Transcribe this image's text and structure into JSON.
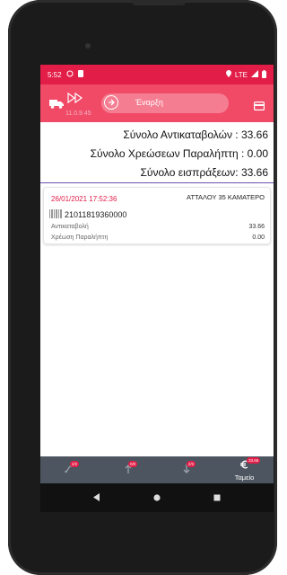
{
  "status_bar": {
    "time": "5:52",
    "network": "LTE"
  },
  "app_bar": {
    "version": "11.0.9.45",
    "start_label": "Έναρξη"
  },
  "totals": {
    "cod_total": "Σύνολο Αντικαταβολών :  33.66",
    "recipient_charges_total": "Σύνολο Χρεώσεων Παραλήπτη :   0.00",
    "receipts_total": "Σύνολο εισπράξεων:  33.66"
  },
  "items": [
    {
      "date": "26/01/2021 17:52:36",
      "address": "ΑΤΤΑΛΟΥ 35 ΚΑΜΑΤΕΡΟ",
      "barcode": "21011819360000",
      "cod_label": "Αντικαταβολή",
      "cod_value": "33.66",
      "charge_label": "Χρέωση Παραλήπτη",
      "charge_value": "0.00"
    }
  ],
  "bottom_nav": {
    "tab1_badge": "2/2",
    "tab2_badge": "0/0",
    "tab3_badge": "2/2",
    "cashier_badge": "33.66",
    "cashier_label": "Ταμείο"
  },
  "colors": {
    "status_bar": "#e21d48",
    "app_bar": "#f04a67",
    "accent_line": "#6c50b0",
    "bottom_nav": "#4d5660"
  },
  "icons": {
    "status": [
      "whatsapp-icon",
      "sim-icon",
      "location-icon",
      "signal-icon",
      "battery-icon"
    ],
    "app_bar": [
      "truck-icon",
      "fast-forward-icon",
      "arrow-right-circle-icon",
      "credit-card-icon"
    ],
    "nav": [
      "route-icon",
      "upload-arrow-icon",
      "download-arrow-icon",
      "euro-icon"
    ],
    "system": [
      "back-icon",
      "home-icon",
      "recents-icon"
    ]
  }
}
